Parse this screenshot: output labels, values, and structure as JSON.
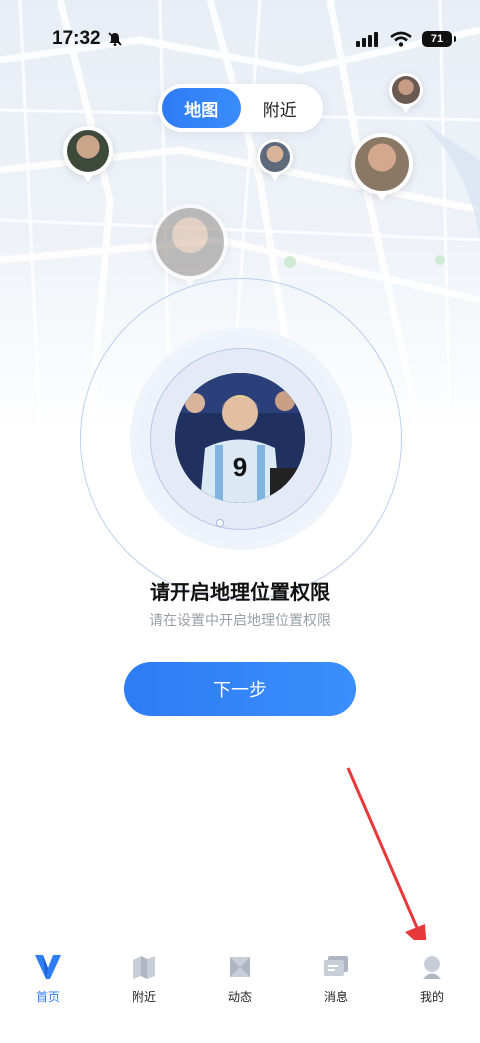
{
  "status_bar": {
    "time": "17:32",
    "battery": "71",
    "icons": [
      "bell-muted-icon",
      "signal-icon",
      "wifi-icon",
      "battery-icon"
    ]
  },
  "segment": {
    "items": [
      {
        "label": "地图",
        "active": true
      },
      {
        "label": "附近",
        "active": false
      }
    ]
  },
  "location": {
    "title": "请开启地理位置权限",
    "subtitle": "请在设置中开启地理位置权限",
    "next_label": "下一步"
  },
  "tab_bar": {
    "items": [
      {
        "label": "首页",
        "icon": "home-v-icon",
        "active": true
      },
      {
        "label": "附近",
        "icon": "nearby-icon",
        "active": false
      },
      {
        "label": "动态",
        "icon": "moments-icon",
        "active": false
      },
      {
        "label": "消息",
        "icon": "message-icon",
        "active": false
      },
      {
        "label": "我的",
        "icon": "profile-icon",
        "active": false
      }
    ]
  },
  "colors": {
    "accent": "#2e7cf6",
    "annotation_arrow": "#e8393a"
  }
}
